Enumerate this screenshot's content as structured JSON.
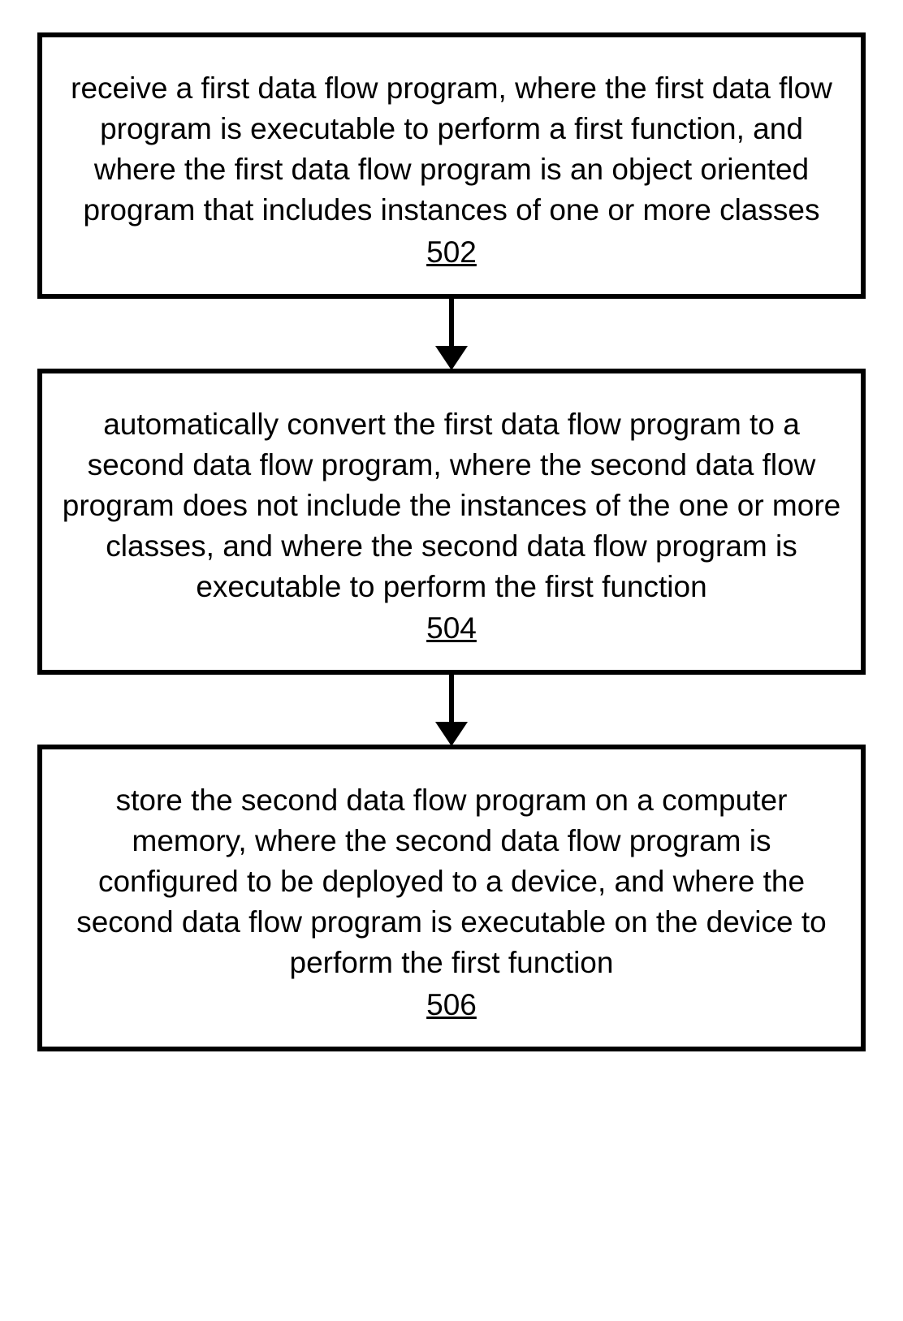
{
  "flowchart": {
    "steps": [
      {
        "text": "receive a first data flow program, where the first data flow program is executable to perform a first function, and where the first data flow program is an object oriented program that includes instances of one or more classes",
        "number": "502"
      },
      {
        "text": "automatically convert the first data flow program to a second data flow program, where the second data flow program does not include the instances of the one or more classes, and where the second data flow program is executable to perform the first function",
        "number": "504"
      },
      {
        "text": "store the second data flow program on a computer memory, where the second data flow program is configured to be deployed to a device, and where the second data flow program is executable on the device to perform the first function",
        "number": "506"
      }
    ]
  }
}
